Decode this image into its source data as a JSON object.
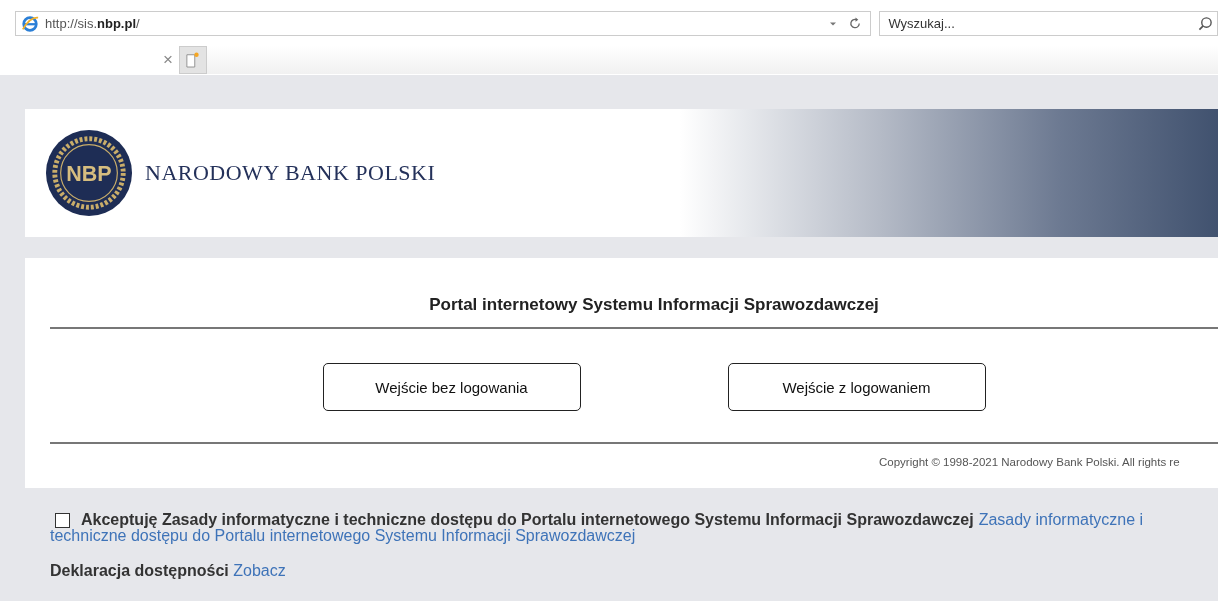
{
  "browser": {
    "url_prefix": "http://sis.",
    "url_domain": "nbp.pl",
    "url_suffix": "/",
    "search": {
      "placeholder": "Wyszukaj..."
    },
    "tab_close": "×"
  },
  "header": {
    "logo_text": "NBP",
    "bank_name": "NARODOWY BANK POLSKI"
  },
  "portal": {
    "title": "Portal internetowy Systemu Informacji Sprawozdawczej",
    "buttons": [
      "Wejście bez logowania",
      "Wejście z logowaniem"
    ],
    "copyright": "Copyright © 1998-2021 Narodowy Bank Polski. All rights re"
  },
  "accept": {
    "checked": false,
    "label": "Akceptuję Zasady informatyczne i techniczne dostępu do Portalu internetowego Systemu Informacji Sprawozdawczej",
    "link_lines": [
      "Zasady informatyczne i",
      "techniczne dostępu do Portalu internetowego Systemu Informacji Sprawozdawczej"
    ]
  },
  "accessibility": {
    "label": "Deklaracja dostępności",
    "link": "Zobacz"
  }
}
